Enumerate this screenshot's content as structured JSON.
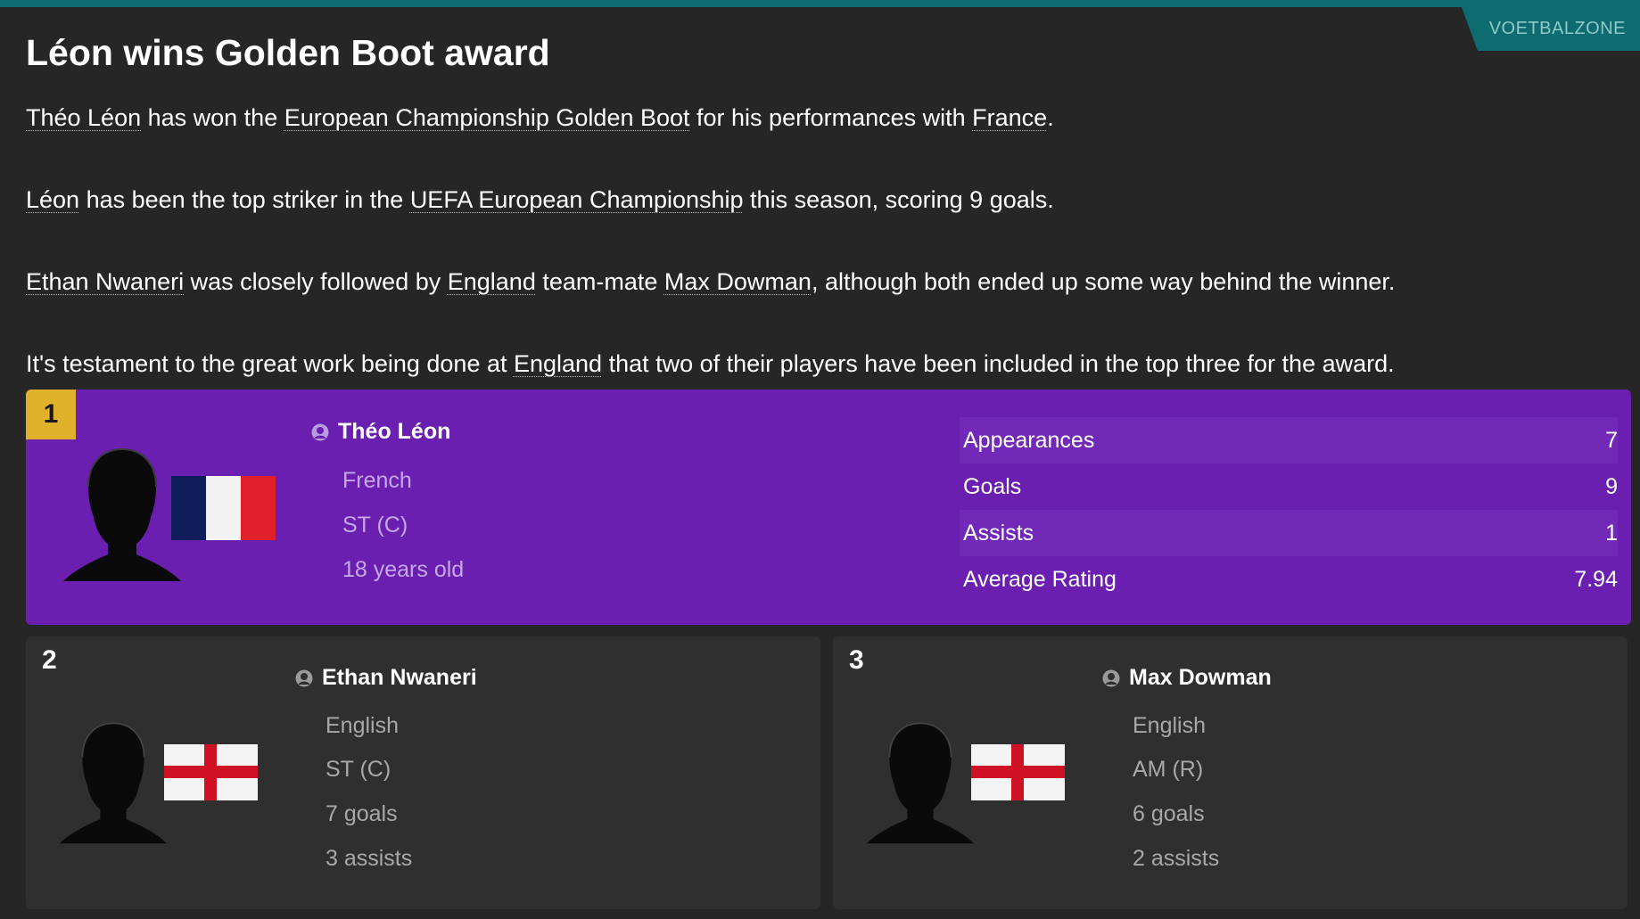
{
  "source": "VOETBALZONE",
  "headline": "Léon wins Golden Boot award",
  "paragraphs": {
    "p1": {
      "player": "Théo Léon",
      "t1": " has won the ",
      "award": "European Championship Golden Boot",
      "t2": " for his performances with ",
      "team": "France",
      "t3": "."
    },
    "p2": {
      "player": "Léon",
      "t1": " has been the top striker in the ",
      "competition": "UEFA European Championship",
      "t2": " this season, scoring 9 goals."
    },
    "p3": {
      "player": "Ethan Nwaneri",
      "t1": " was closely followed by ",
      "team": "England",
      "t2": " team-mate ",
      "player2": "Max Dowman",
      "t3": ", although both ended up some way behind the winner."
    },
    "p4": {
      "t1": "It's testament to the great work being done at ",
      "team": "England",
      "t2": " that two of their players have been included in the top three for the award."
    }
  },
  "winner": {
    "rank": "1",
    "name": "Théo Léon",
    "nationality": "French",
    "position": "ST (C)",
    "age": "18 years old",
    "flag": "france-flag",
    "stats": [
      {
        "label": "Appearances",
        "value": "7"
      },
      {
        "label": "Goals",
        "value": "9"
      },
      {
        "label": "Assists",
        "value": "1"
      },
      {
        "label": "Average Rating",
        "value": "7.94"
      }
    ]
  },
  "runners_up": [
    {
      "rank": "2",
      "name": "Ethan Nwaneri",
      "nationality": "English",
      "position": "ST (C)",
      "goals": "7 goals",
      "assists": "3 assists",
      "flag": "england-flag"
    },
    {
      "rank": "3",
      "name": "Max Dowman",
      "nationality": "English",
      "position": "AM (R)",
      "goals": "6 goals",
      "assists": "2 assists",
      "flag": "england-flag"
    }
  ],
  "colors": {
    "background": "#262626",
    "accent_teal": "#0e6b6f",
    "winner_card": "#6a1fb0",
    "rank_badge": "#e0b12a",
    "runner_card": "#2f2f2f"
  }
}
